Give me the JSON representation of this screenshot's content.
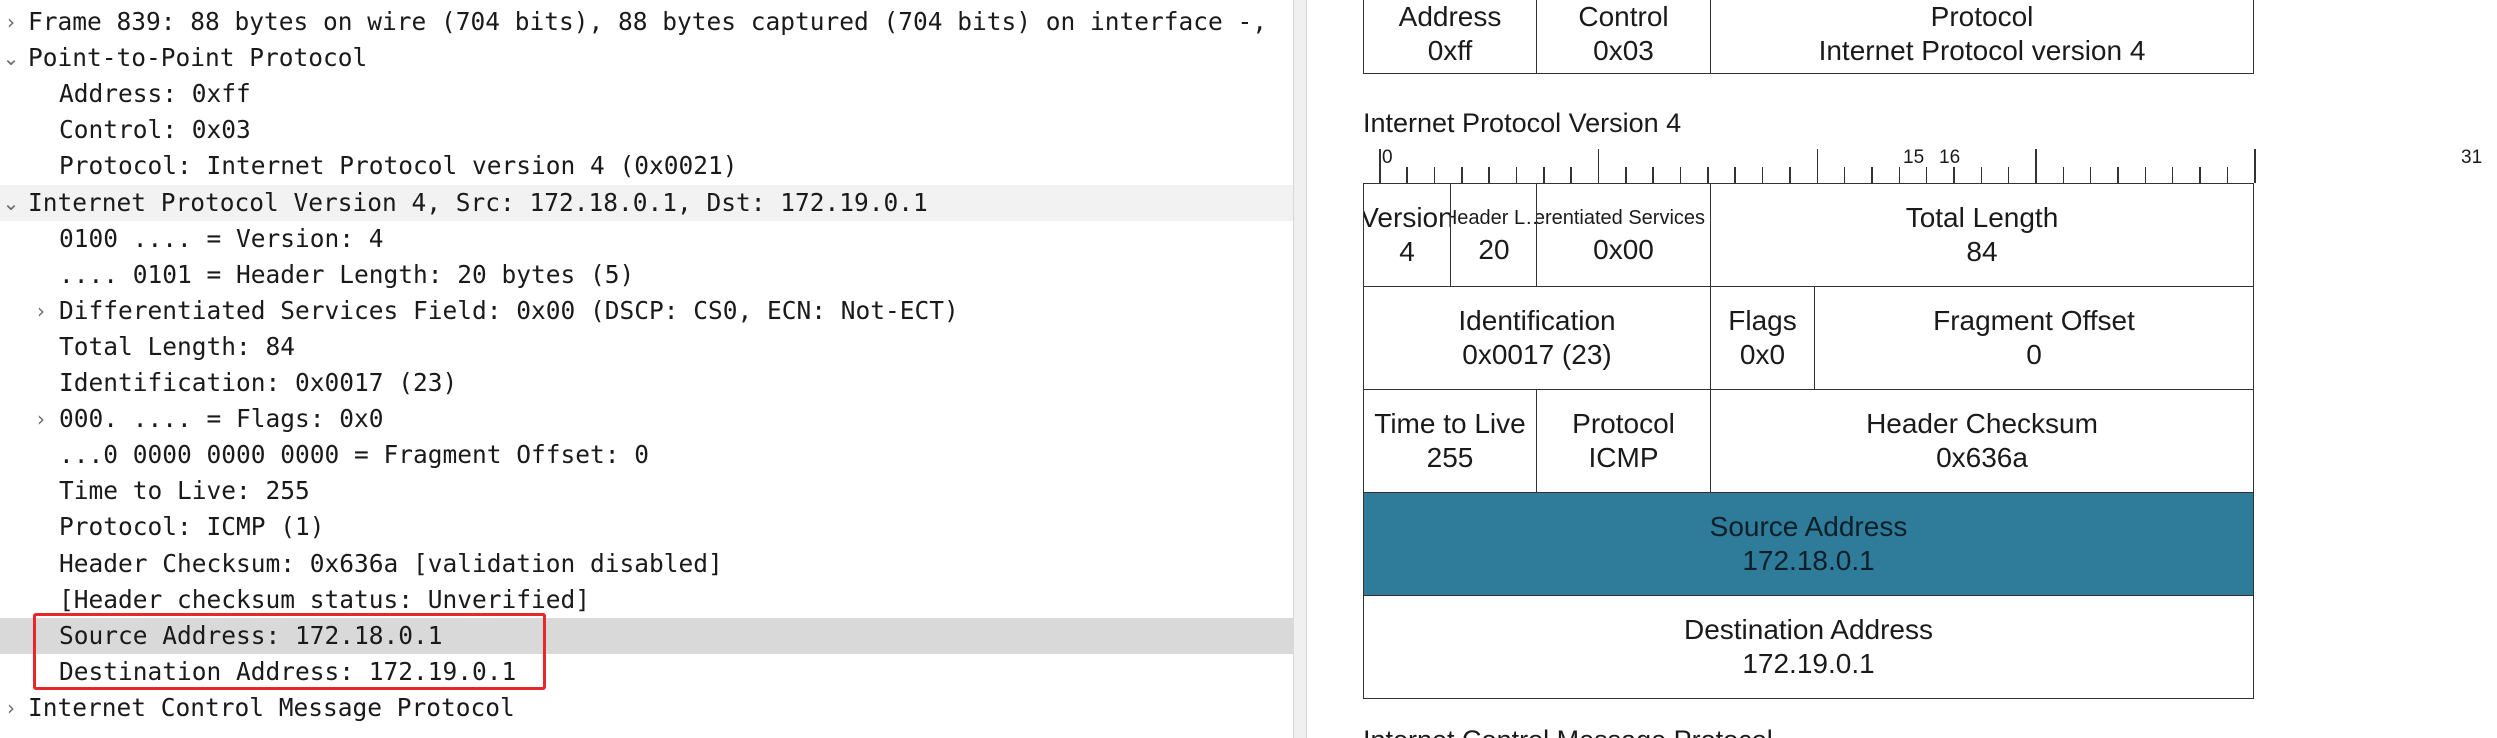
{
  "tree": [
    {
      "arrow": "›",
      "level": 0,
      "text": "Frame 839: 88 bytes on wire (704 bits), 88 bytes captured (704 bits) on interface -,"
    },
    {
      "arrow": "⌄",
      "level": 0,
      "text": "Point-to-Point Protocol"
    },
    {
      "arrow": "",
      "level": 1,
      "text": "Address: 0xff"
    },
    {
      "arrow": "",
      "level": 1,
      "text": "Control: 0x03"
    },
    {
      "arrow": "",
      "level": 1,
      "text": "Protocol: Internet Protocol version 4 (0x0021)"
    },
    {
      "arrow": "⌄",
      "level": 0,
      "text": "Internet Protocol Version 4, Src: 172.18.0.1, Dst: 172.19.0.1"
    },
    {
      "arrow": "",
      "level": 1,
      "text": "0100 .... = Version: 4"
    },
    {
      "arrow": "",
      "level": 1,
      "text": ".... 0101 = Header Length: 20 bytes (5)"
    },
    {
      "arrow": "›",
      "level": 1,
      "text": "Differentiated Services Field: 0x00 (DSCP: CS0, ECN: Not-ECT)"
    },
    {
      "arrow": "",
      "level": 1,
      "text": "Total Length: 84"
    },
    {
      "arrow": "",
      "level": 1,
      "text": "Identification: 0x0017 (23)"
    },
    {
      "arrow": "›",
      "level": 1,
      "text": "000. .... = Flags: 0x0"
    },
    {
      "arrow": "",
      "level": 1,
      "text": "...0 0000 0000 0000 = Fragment Offset: 0"
    },
    {
      "arrow": "",
      "level": 1,
      "text": "Time to Live: 255"
    },
    {
      "arrow": "",
      "level": 1,
      "text": "Protocol: ICMP (1)"
    },
    {
      "arrow": "",
      "level": 1,
      "text": "Header Checksum: 0x636a [validation disabled]"
    },
    {
      "arrow": "",
      "level": 1,
      "text": "[Header checksum status: Unverified]"
    },
    {
      "arrow": "",
      "level": 1,
      "text": "Source Address: 172.18.0.1",
      "selected": true
    },
    {
      "arrow": "",
      "level": 1,
      "text": "Destination Address: 172.19.0.1"
    },
    {
      "arrow": "›",
      "level": 0,
      "text": "Internet Control Message Protocol"
    }
  ],
  "ppp_fields": [
    {
      "name": "Address",
      "value": "0xff"
    },
    {
      "name": "Control",
      "value": "0x03"
    },
    {
      "name": "Protocol",
      "value": "Internet Protocol version 4"
    }
  ],
  "ip_title": "Internet Protocol Version 4",
  "ruler_labels": [
    "0",
    "15",
    "16",
    "31"
  ],
  "ip_fields": [
    {
      "name": "Version",
      "value": "4"
    },
    {
      "name": "Header L…",
      "value": "20"
    },
    {
      "name": "Differentiated Services F…",
      "value": "0x00"
    },
    {
      "name": "Total Length",
      "value": "84"
    },
    {
      "name": "Identification",
      "value": "0x0017 (23)"
    },
    {
      "name": "Flags",
      "value": "0x0"
    },
    {
      "name": "Fragment Offset",
      "value": "0"
    },
    {
      "name": "Time to Live",
      "value": "255"
    },
    {
      "name": "Protocol",
      "value": "ICMP"
    },
    {
      "name": "Header Checksum",
      "value": "0x636a"
    },
    {
      "name": "Source Address",
      "value": "172.18.0.1"
    },
    {
      "name": "Destination Address",
      "value": "172.19.0.1"
    }
  ],
  "next_title": "Internet Control Message Protocol",
  "colors": {
    "selected_field": "#2e7b9a",
    "selected_row": "#d9d9d9",
    "highlight_box": "#e8262c"
  }
}
